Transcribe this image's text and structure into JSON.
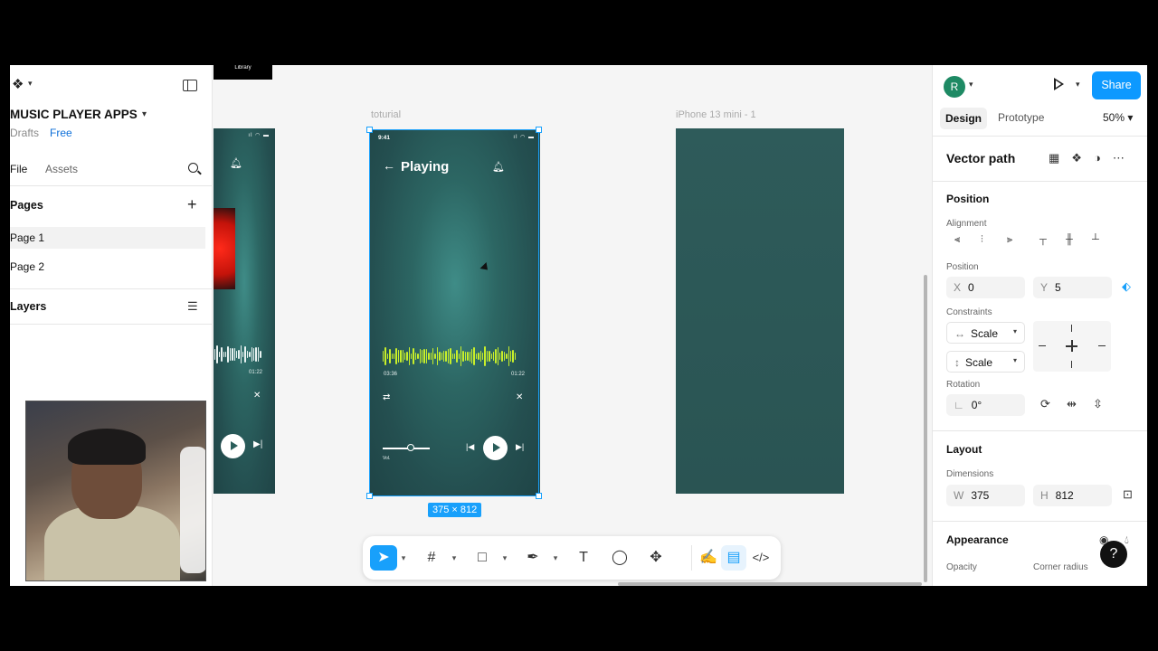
{
  "left_panel": {
    "project_title": "MUSIC PLAYER APPS",
    "drafts": "Drafts",
    "plan": "Free",
    "tabs": {
      "file": "File",
      "assets": "Assets"
    },
    "pages_heading": "Pages",
    "pages": [
      "Page 1",
      "Page 2"
    ],
    "layers_heading": "Layers"
  },
  "canvas": {
    "library_tag": "Library",
    "frames": [
      {
        "label": ""
      },
      {
        "label": "toturial",
        "time": "9:41",
        "title": "Playing",
        "back": "←",
        "time_elapsed": "03:36",
        "time_total": "01:22",
        "vol_label": "Vol."
      },
      {
        "label": "iPhone 13 mini - 1"
      }
    ],
    "frameA": {
      "time_total": "01:22"
    },
    "dimensions_badge": "375 × 812",
    "volume_level": 0.6
  },
  "toolbar": {
    "tools": [
      "move-tool",
      "frame-tool",
      "shape-tool",
      "pen-tool",
      "text-tool",
      "comment-tool",
      "actions-tool",
      "draw-mode",
      "design-mode",
      "dev-mode"
    ]
  },
  "right_panel": {
    "avatar_initial": "R",
    "share_label": "Share",
    "tab_design": "Design",
    "tab_prototype": "Prototype",
    "zoom": "50%",
    "selection_name": "Vector path",
    "position_heading": "Position",
    "alignment_label": "Alignment",
    "position_label": "Position",
    "x_key": "X",
    "x_value": "0",
    "y_key": "Y",
    "y_value": "5",
    "constraints_label": "Constraints",
    "constraint_h": "Scale",
    "constraint_v": "Scale",
    "rotation_label": "Rotation",
    "rotation_value": "0°",
    "layout_heading": "Layout",
    "dimensions_label": "Dimensions",
    "w_key": "W",
    "w_value": "375",
    "h_key": "H",
    "h_value": "812",
    "appearance_heading": "Appearance",
    "opacity_label": "Opacity",
    "corner_radius_label": "Corner radius",
    "help": "?"
  },
  "colors": {
    "accent": "#18a0fb",
    "share": "#0d99ff",
    "frame_bg": "#2c6663",
    "waveform": "#c8ef2a"
  }
}
